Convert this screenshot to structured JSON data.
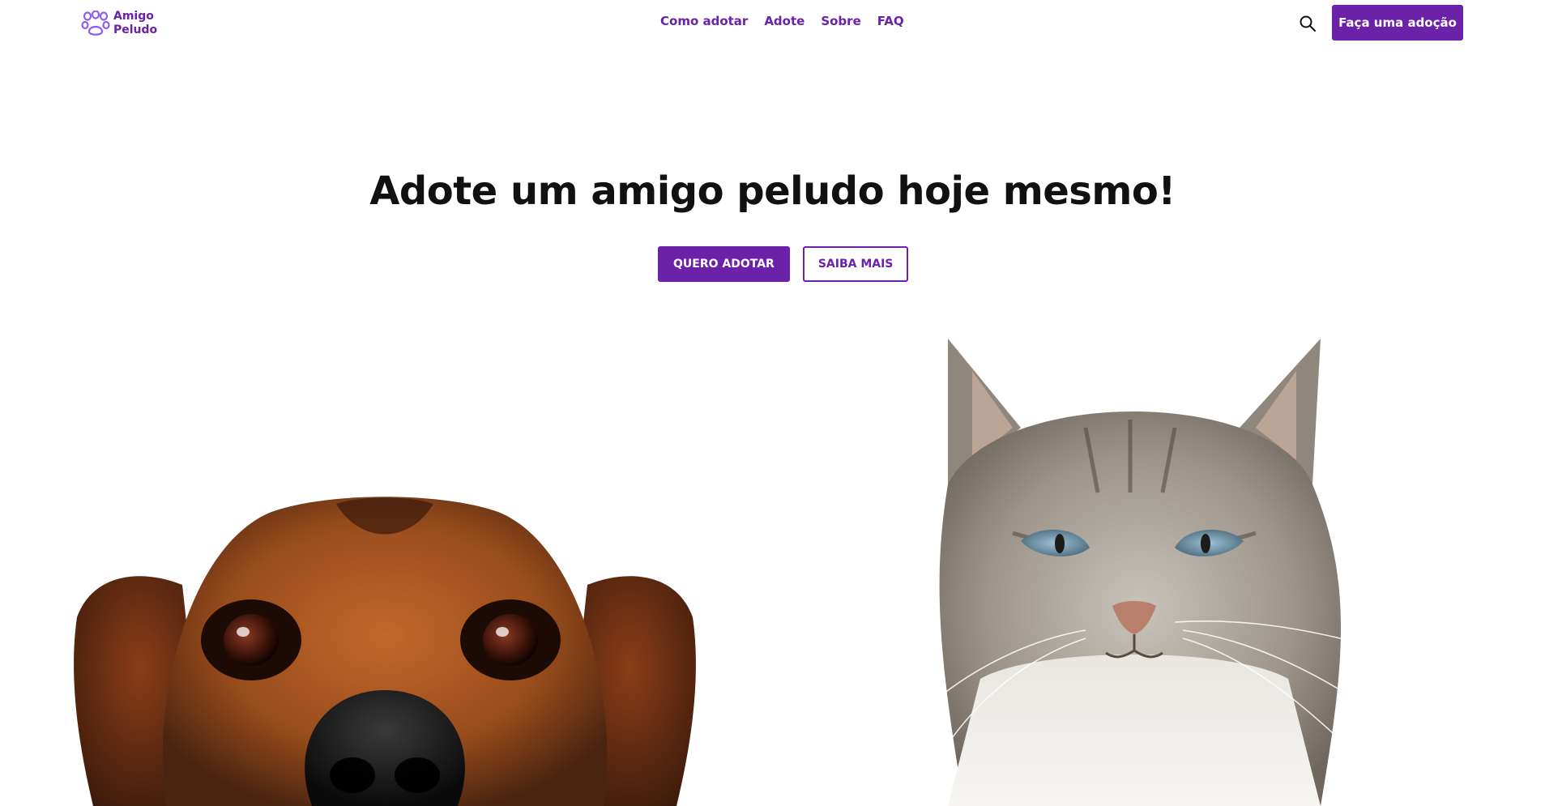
{
  "brand": {
    "line1": "Amigo",
    "line2": "Peludo",
    "color": "#6b21a8"
  },
  "nav": {
    "links": [
      {
        "label": "Como adotar"
      },
      {
        "label": "Adote"
      },
      {
        "label": "Sobre"
      },
      {
        "label": "FAQ"
      }
    ],
    "search_icon": "search-icon",
    "cta_label": "Faça uma adoção"
  },
  "hero": {
    "title": "Adote um amigo peludo hoje mesmo!",
    "primary_label": "QUERO ADOTAR",
    "secondary_label": "SAIBA MAIS"
  },
  "images": {
    "dog": "dog-photo",
    "cat": "cat-photo"
  }
}
